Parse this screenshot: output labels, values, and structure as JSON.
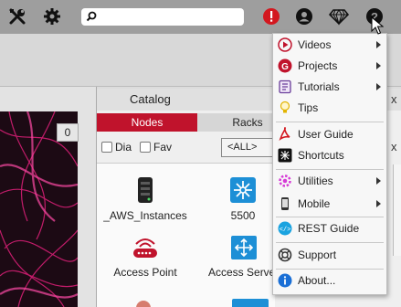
{
  "toolbar": {
    "search_value": "",
    "icons": [
      "tools-icon",
      "gear-icon",
      "search-icon",
      "alert-icon",
      "user-icon",
      "diamond-icon",
      "help-icon"
    ]
  },
  "left_pane": {
    "tab_number": "0"
  },
  "catalog": {
    "title": "Catalog",
    "tabs": [
      "Nodes",
      "Racks"
    ],
    "filters": {
      "dia_label": "Dia",
      "fav_label": "Fav"
    },
    "select_value": "<ALL>",
    "close_label": "x",
    "nodes": [
      {
        "label": "_AWS_Instances"
      },
      {
        "label": "5500"
      },
      {
        "label": "Access Point"
      },
      {
        "label": "Access Serve"
      }
    ]
  },
  "menu": {
    "items": [
      {
        "label": "Videos",
        "icon": "video-icon",
        "submenu": true
      },
      {
        "label": "Projects",
        "icon": "projects-icon",
        "submenu": true
      },
      {
        "label": "Tutorials",
        "icon": "tutorials-icon",
        "submenu": true
      },
      {
        "label": "Tips",
        "icon": "lightbulb-icon",
        "submenu": false
      },
      {
        "label": "User Guide",
        "icon": "pdf-icon",
        "submenu": false
      },
      {
        "label": "Shortcuts",
        "icon": "keyboard-icon",
        "submenu": false
      },
      {
        "label": "Utilities",
        "icon": "utilities-icon",
        "submenu": true
      },
      {
        "label": "Mobile",
        "icon": "mobile-icon",
        "submenu": true
      },
      {
        "label": "REST Guide",
        "icon": "api-icon",
        "submenu": false
      },
      {
        "label": "Support",
        "icon": "support-icon",
        "submenu": false
      },
      {
        "label": "About...",
        "icon": "info-icon",
        "submenu": false
      }
    ]
  },
  "colors": {
    "accent": "#c0132c",
    "toolbar": "#9e9e9e",
    "alert": "#d3171f"
  }
}
